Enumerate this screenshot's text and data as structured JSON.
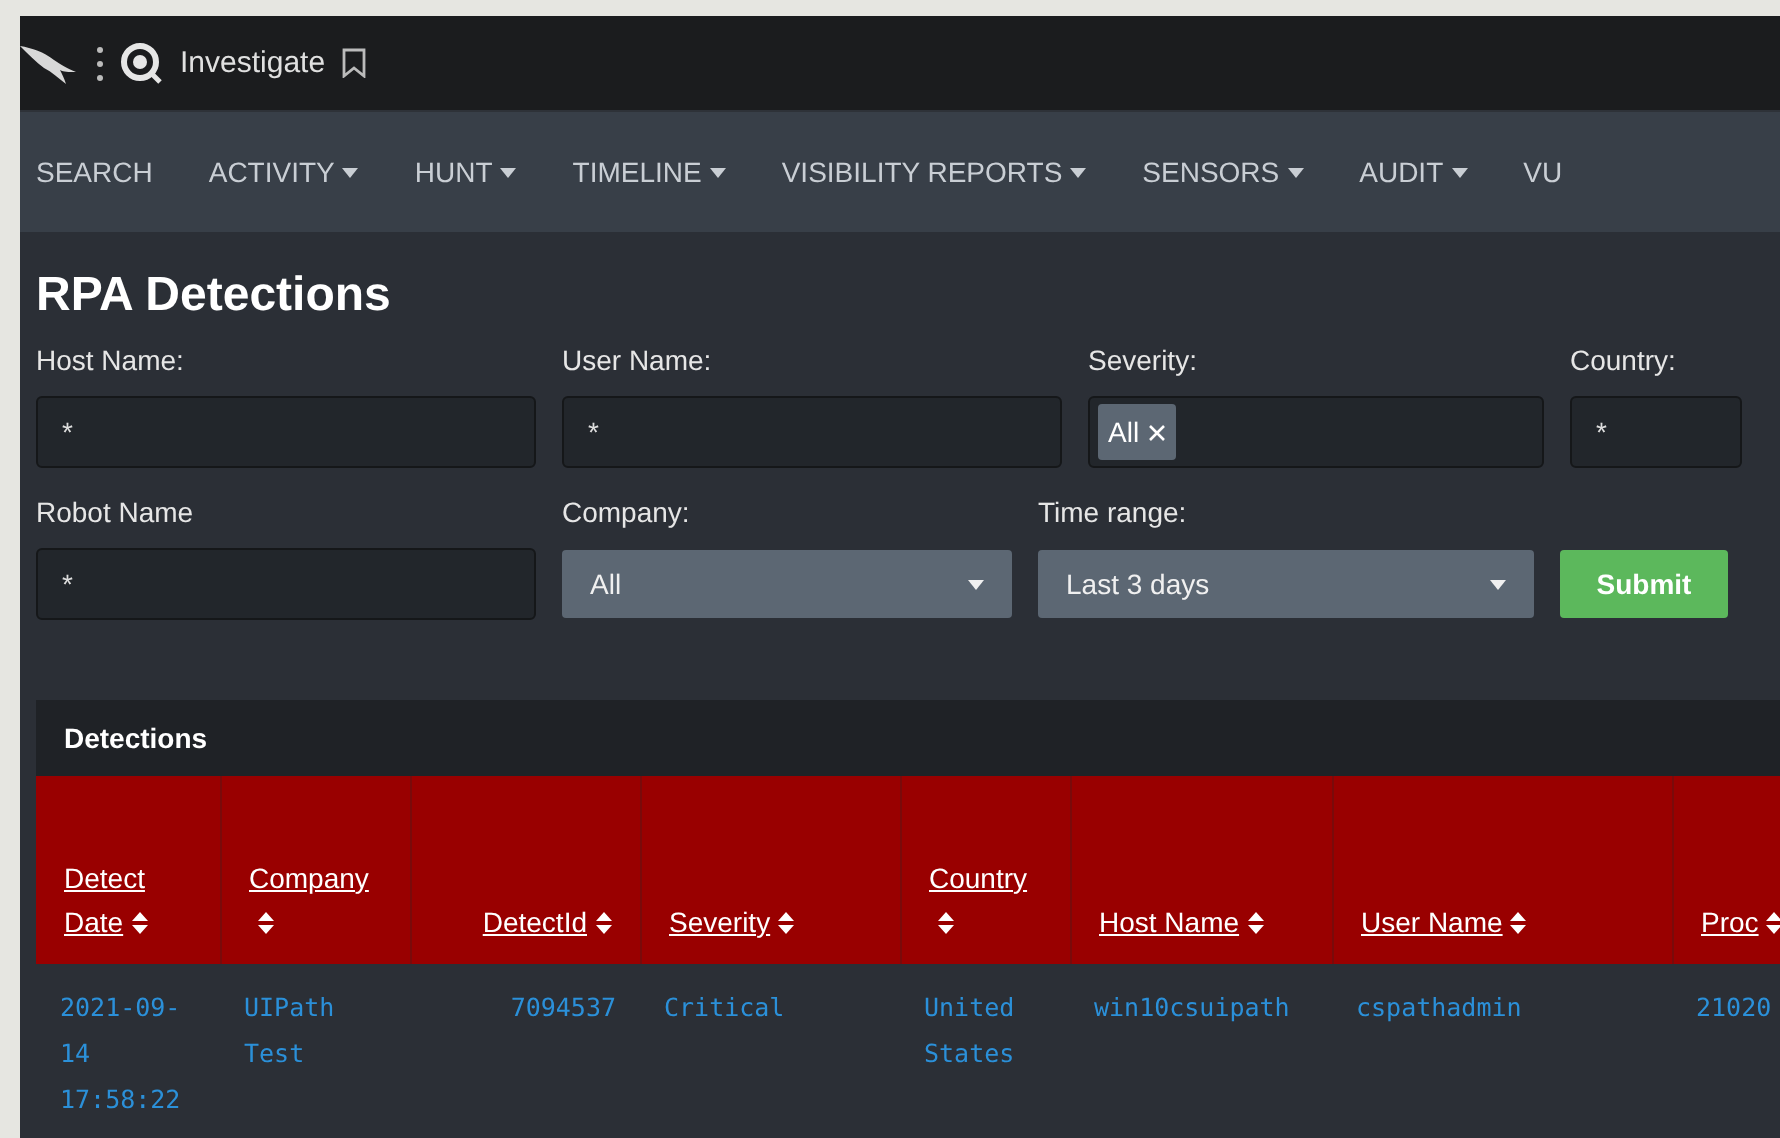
{
  "top_bar": {
    "app_title": "Investigate"
  },
  "nav": [
    {
      "label": "SEARCH",
      "dropdown": false
    },
    {
      "label": "ACTIVITY",
      "dropdown": true
    },
    {
      "label": "HUNT",
      "dropdown": true
    },
    {
      "label": "TIMELINE",
      "dropdown": true
    },
    {
      "label": "VISIBILITY REPORTS",
      "dropdown": true
    },
    {
      "label": "SENSORS",
      "dropdown": true
    },
    {
      "label": "AUDIT",
      "dropdown": true
    },
    {
      "label": "VU",
      "dropdown": false
    }
  ],
  "page_title": "RPA Detections",
  "filter_rows": [
    [
      {
        "kind": "text",
        "label": "Host Name:",
        "value": "*"
      },
      {
        "kind": "text",
        "label": "User Name:",
        "value": "*"
      },
      {
        "kind": "tags",
        "label": "Severity:",
        "tags": [
          "All"
        ]
      },
      {
        "kind": "text",
        "label": "Country:",
        "value": "*"
      }
    ],
    [
      {
        "kind": "text",
        "label": "Robot Name",
        "value": "*"
      },
      {
        "kind": "select",
        "label": "Company:",
        "value": "All"
      },
      {
        "kind": "select",
        "label": "Time range:",
        "value": "Last 3 days"
      },
      {
        "kind": "submit",
        "label": "Submit"
      }
    ]
  ],
  "table": {
    "title": "Detections",
    "columns": [
      {
        "label": "Detect Date",
        "kind": "text"
      },
      {
        "label": "Company",
        "kind": "text"
      },
      {
        "label": "DetectId",
        "kind": "number"
      },
      {
        "label": "Severity",
        "kind": "text"
      },
      {
        "label": "Country",
        "kind": "text"
      },
      {
        "label": "Host Name",
        "kind": "text"
      },
      {
        "label": "User Name",
        "kind": "text"
      },
      {
        "label": "Proc",
        "kind": "text"
      }
    ],
    "rows": [
      [
        "2021-09-14 17:58:22",
        "UIPath Test",
        "7094537",
        "Critical",
        "United States",
        "win10csuipath",
        "cspathadmin",
        "21020"
      ]
    ]
  }
}
